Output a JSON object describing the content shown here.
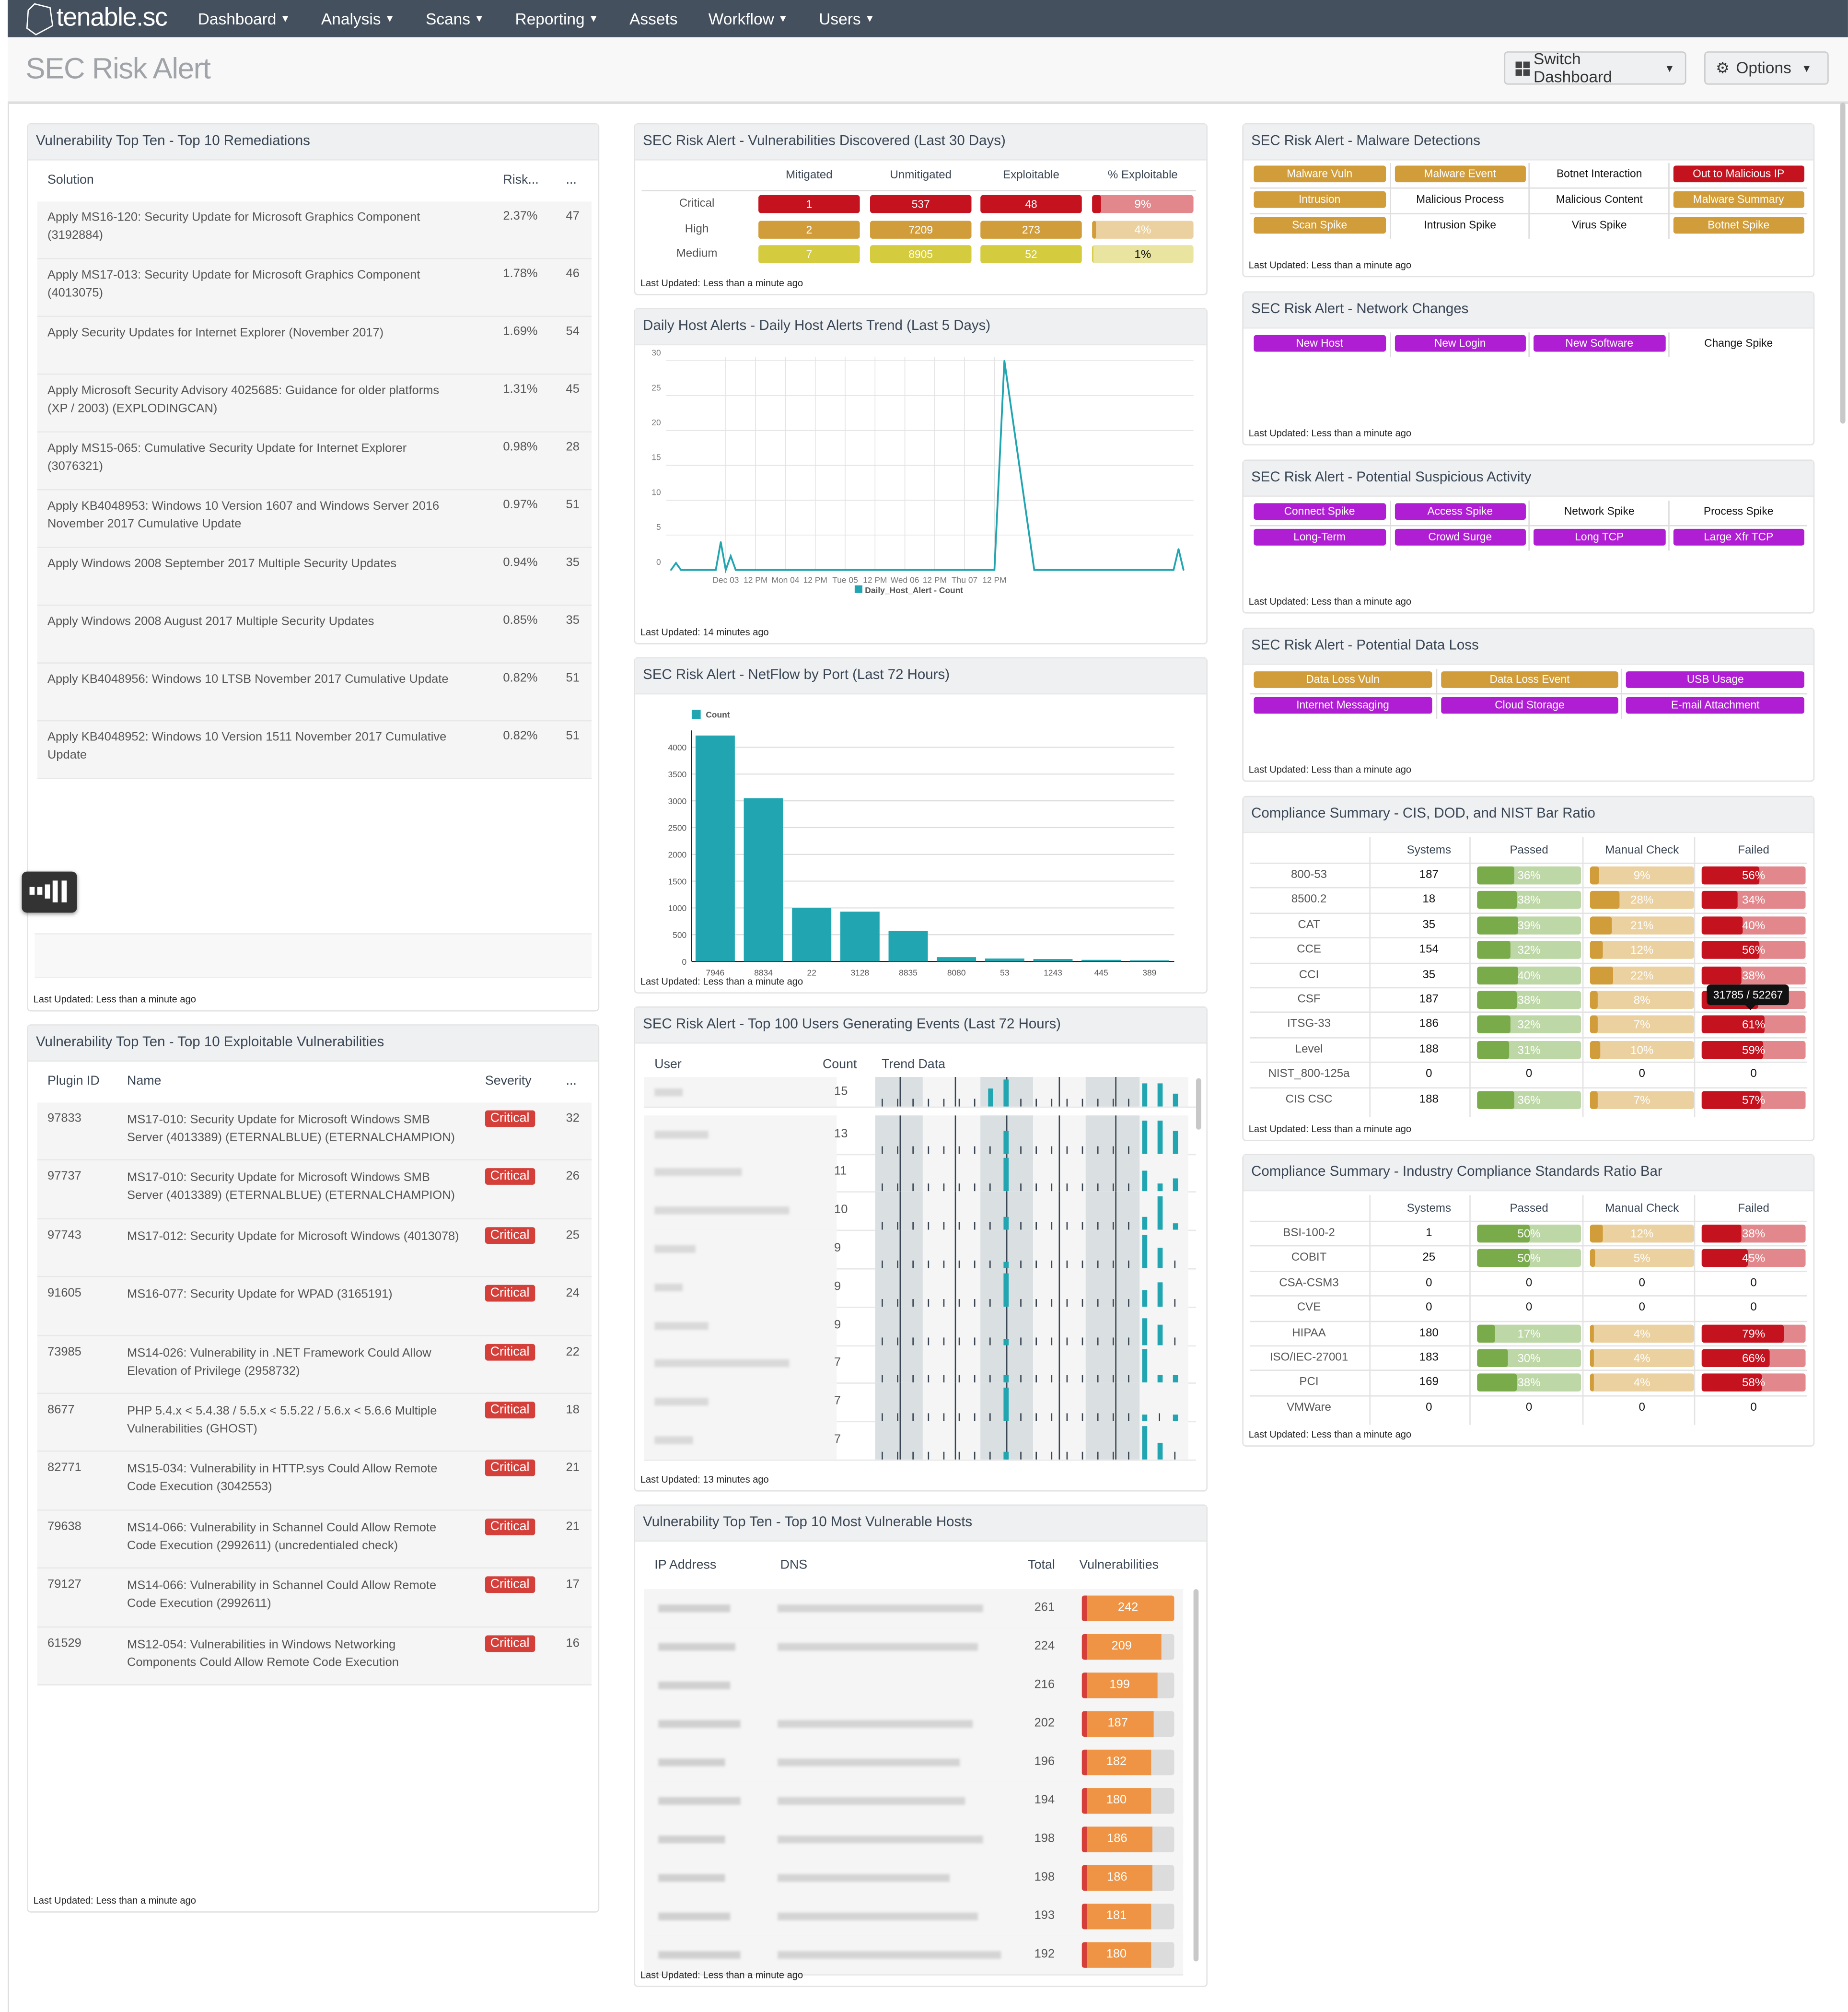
{
  "app": {
    "logo_text": "tenable.sc"
  },
  "nav": [
    {
      "label": "Dashboard",
      "has_menu": true
    },
    {
      "label": "Analysis",
      "has_menu": true
    },
    {
      "label": "Scans",
      "has_menu": true
    },
    {
      "label": "Reporting",
      "has_menu": true
    },
    {
      "label": "Assets",
      "has_menu": false
    },
    {
      "label": "Workflow",
      "has_menu": true
    },
    {
      "label": "Users",
      "has_menu": true
    }
  ],
  "page": {
    "title": "SEC Risk Alert",
    "switch_dashboard_label": "Switch Dashboard",
    "options_label": "Options"
  },
  "remediations": {
    "title": "Vulnerability Top Ten - Top 10 Remediations",
    "headers": [
      "Solution",
      "Risk...",
      "..."
    ],
    "rows": [
      [
        "Apply MS16-120: Security Update for Microsoft Graphics Component (3192884)",
        "2.37%",
        "47"
      ],
      [
        "Apply MS17-013: Security Update for Microsoft Graphics Component (4013075)",
        "1.78%",
        "46"
      ],
      [
        "Apply Security Updates for Internet Explorer (November 2017)",
        "1.69%",
        "54"
      ],
      [
        "Apply Microsoft Security Advisory 4025685: Guidance for older platforms (XP / 2003) (EXPLODINGCAN)",
        "1.31%",
        "45"
      ],
      [
        "Apply MS15-065: Cumulative Security Update for Internet Explorer (3076321)",
        "0.98%",
        "28"
      ],
      [
        "Apply KB4048953: Windows 10 Version 1607 and Windows Server 2016 November 2017 Cumulative Update",
        "0.97%",
        "51"
      ],
      [
        "Apply Windows 2008 September 2017 Multiple Security Updates",
        "0.94%",
        "35"
      ],
      [
        "Apply Windows 2008 August 2017 Multiple Security Updates",
        "0.85%",
        "35"
      ],
      [
        "Apply KB4048956: Windows 10 LTSB November 2017 Cumulative Update",
        "0.82%",
        "51"
      ],
      [
        "Apply KB4048952: Windows 10 Version 1511 November 2017 Cumulative Update",
        "0.82%",
        "51"
      ]
    ],
    "updated": "Last Updated: Less than a minute ago"
  },
  "exploitable": {
    "title": "Vulnerability Top Ten - Top 10 Exploitable Vulnerabilities",
    "headers": [
      "Plugin ID",
      "Name",
      "Severity",
      "..."
    ],
    "rows": [
      [
        "97833",
        "MS17-010: Security Update for Microsoft Windows SMB Server (4013389) (ETERNALBLUE) (ETERNALCHAMPION)",
        "Critical",
        "32"
      ],
      [
        "97737",
        "MS17-010: Security Update for Microsoft Windows SMB Server (4013389) (ETERNALBLUE) (ETERNALCHAMPION)",
        "Critical",
        "26"
      ],
      [
        "97743",
        "MS17-012: Security Update for Microsoft Windows (4013078)",
        "Critical",
        "25"
      ],
      [
        "91605",
        "MS16-077: Security Update for WPAD (3165191)",
        "Critical",
        "24"
      ],
      [
        "73985",
        "MS14-026: Vulnerability in .NET Framework Could Allow Elevation of Privilege (2958732)",
        "Critical",
        "22"
      ],
      [
        "8677",
        "PHP 5.4.x < 5.4.38 / 5.5.x < 5.5.22 / 5.6.x < 5.6.6 Multiple Vulnerabilities (GHOST)",
        "Critical",
        "18"
      ],
      [
        "82771",
        "MS15-034: Vulnerability in HTTP.sys Could Allow Remote Code Execution (3042553)",
        "Critical",
        "21"
      ],
      [
        "79638",
        "MS14-066: Vulnerability in Schannel Could Allow Remote Code Execution (2992611) (uncredentialed check)",
        "Critical",
        "21"
      ],
      [
        "79127",
        "MS14-066: Vulnerability in Schannel Could Allow Remote Code Execution (2992611)",
        "Critical",
        "17"
      ],
      [
        "61529",
        "MS12-054: Vulnerabilities in Windows Networking Components Could Allow Remote Code Execution",
        "Critical",
        "16"
      ]
    ],
    "updated": "Last Updated: Less than a minute ago"
  },
  "vulns_discovered": {
    "title": "SEC Risk Alert - Vulnerabilities Discovered (Last 30 Days)",
    "headers": [
      "Mitigated",
      "Unmitigated",
      "Exploitable",
      "% Exploitable"
    ],
    "rows": [
      {
        "label": "Critical",
        "mitigated": "1",
        "unmitigated": "537",
        "exploitable": "48",
        "pct": "9%",
        "pct_value": 9,
        "color": "#c4121f",
        "light": "#e2888d",
        "pct_text_color": "#ffffff"
      },
      {
        "label": "High",
        "mitigated": "2",
        "unmitigated": "7209",
        "exploitable": "273",
        "pct": "4%",
        "pct_value": 4,
        "color": "#d19d3b",
        "light": "#ebd0a0",
        "pct_text_color": "#ffffff"
      },
      {
        "label": "Medium",
        "mitigated": "7",
        "unmitigated": "8905",
        "exploitable": "52",
        "pct": "1%",
        "pct_value": 1,
        "color": "#d4cb3e",
        "light": "#e9e4a0",
        "pct_text_color": "#111111"
      }
    ],
    "updated": "Last Updated: Less than a minute ago"
  },
  "host_alerts": {
    "title": "Daily Host Alerts - Daily Host Alerts Trend (Last 5 Days)",
    "updated": "Last Updated: 14 minutes ago"
  },
  "netflow": {
    "title": "SEC Risk Alert - NetFlow by Port (Last 72 Hours)",
    "updated": "Last Updated: Less than a minute ago"
  },
  "top_users": {
    "title": "SEC Risk Alert - Top 100 Users Generating Events (Last 72 Hours)",
    "headers": [
      "User",
      "Count",
      "Trend Data"
    ],
    "counts": [
      "15",
      "13",
      "11",
      "10",
      "9",
      "9",
      "9",
      "7",
      "7",
      "7"
    ],
    "updated": "Last Updated: 13 minutes ago"
  },
  "vuln_hosts": {
    "title": "Vulnerability Top Ten - Top 10 Most Vulnerable Hosts",
    "headers": [
      "IP Address",
      "DNS",
      "Total",
      "Vulnerabilities"
    ],
    "rows": [
      {
        "total": "261",
        "vulns": "242",
        "ratio": 0.927
      },
      {
        "total": "224",
        "vulns": "209",
        "ratio": 0.933
      },
      {
        "total": "216",
        "vulns": "199",
        "ratio": 0.921
      },
      {
        "total": "202",
        "vulns": "187",
        "ratio": 0.926
      },
      {
        "total": "196",
        "vulns": "182",
        "ratio": 0.929
      },
      {
        "total": "194",
        "vulns": "180",
        "ratio": 0.928
      },
      {
        "total": "198",
        "vulns": "186",
        "ratio": 0.939
      },
      {
        "total": "198",
        "vulns": "186",
        "ratio": 0.939
      },
      {
        "total": "193",
        "vulns": "181",
        "ratio": 0.938
      },
      {
        "total": "192",
        "vulns": "180",
        "ratio": 0.938
      }
    ],
    "updated": "Last Updated: Less than a minute ago"
  },
  "malware": {
    "title": "SEC Risk Alert - Malware Detections",
    "cells": [
      [
        {
          "label": "Malware Vuln",
          "color": "#d19d3b"
        },
        {
          "label": "Malware Event",
          "color": "#d19d3b"
        },
        {
          "label": "Botnet Interaction",
          "color": null
        },
        {
          "label": "Out to Malicious IP",
          "color": "#c4121f"
        }
      ],
      [
        {
          "label": "Intrusion",
          "color": "#d19d3b"
        },
        {
          "label": "Malicious Process",
          "color": null
        },
        {
          "label": "Malicious Content",
          "color": null
        },
        {
          "label": "Malware Summary",
          "color": "#d19d3b"
        }
      ],
      [
        {
          "label": "Scan Spike",
          "color": "#d19d3b"
        },
        {
          "label": "Intrusion Spike",
          "color": null
        },
        {
          "label": "Virus Spike",
          "color": null
        },
        {
          "label": "Botnet Spike",
          "color": "#d19d3b"
        }
      ]
    ],
    "updated": "Last Updated: Less than a minute ago"
  },
  "network_changes": {
    "title": "SEC Risk Alert - Network Changes",
    "cells": [
      [
        {
          "label": "New Host",
          "color": "#b01ed3"
        },
        {
          "label": "New Login",
          "color": "#b01ed3"
        },
        {
          "label": "New Software",
          "color": "#b01ed3"
        },
        {
          "label": "Change Spike",
          "color": null
        }
      ]
    ],
    "updated": "Last Updated: Less than a minute ago"
  },
  "suspicious": {
    "title": "SEC Risk Alert - Potential Suspicious Activity",
    "cells": [
      [
        {
          "label": "Connect Spike",
          "color": "#b01ed3"
        },
        {
          "label": "Access Spike",
          "color": "#b01ed3"
        },
        {
          "label": "Network Spike",
          "color": null
        },
        {
          "label": "Process Spike",
          "color": null
        }
      ],
      [
        {
          "label": "Long-Term",
          "color": "#b01ed3"
        },
        {
          "label": "Crowd Surge",
          "color": "#b01ed3"
        },
        {
          "label": "Long TCP",
          "color": "#b01ed3"
        },
        {
          "label": "Large Xfr TCP",
          "color": "#b01ed3"
        }
      ]
    ],
    "updated": "Last Updated: Less than a minute ago"
  },
  "data_loss": {
    "title": "SEC Risk Alert - Potential Data Loss",
    "cells": [
      [
        {
          "label": "Data Loss Vuln",
          "color": "#d19d3b"
        },
        {
          "label": "Data Loss Event",
          "color": "#d19d3b"
        },
        {
          "label": "USB Usage",
          "color": "#b01ed3"
        }
      ],
      [
        {
          "label": "Internet Messaging",
          "color": "#b01ed3"
        },
        {
          "label": "Cloud Storage",
          "color": "#b01ed3"
        },
        {
          "label": "E-mail Attachment",
          "color": "#b01ed3"
        }
      ]
    ],
    "updated": "Last Updated: Less than a minute ago"
  },
  "compliance_cis": {
    "title": "Compliance Summary - CIS, DOD, and NIST Bar Ratio",
    "headers": [
      "Systems",
      "Passed",
      "Manual Check",
      "Failed"
    ],
    "rows": [
      {
        "name": "800-53",
        "systems": "187",
        "passed": 36,
        "manual": 9,
        "failed": 56
      },
      {
        "name": "8500.2",
        "systems": "18",
        "passed": 38,
        "manual": 28,
        "failed": 34
      },
      {
        "name": "CAT",
        "systems": "35",
        "passed": 39,
        "manual": 21,
        "failed": 40
      },
      {
        "name": "CCE",
        "systems": "154",
        "passed": 32,
        "manual": 12,
        "failed": 56
      },
      {
        "name": "CCI",
        "systems": "35",
        "passed": 40,
        "manual": 22,
        "failed": 38
      },
      {
        "name": "CSF",
        "systems": "187",
        "passed": 38,
        "manual": 8,
        "failed": 54
      },
      {
        "name": "ITSG-33",
        "systems": "186",
        "passed": 32,
        "manual": 7,
        "failed": 61
      },
      {
        "name": "Level",
        "systems": "188",
        "passed": 31,
        "manual": 10,
        "failed": 59
      },
      {
        "name": "NIST_800-125a",
        "systems": "0",
        "passed": null,
        "manual": null,
        "failed": null
      },
      {
        "name": "CIS CSC",
        "systems": "188",
        "passed": 36,
        "manual": 7,
        "failed": 57
      }
    ],
    "tooltip": "31785 / 52267",
    "updated": "Last Updated: Less than a minute ago"
  },
  "compliance_industry": {
    "title": "Compliance Summary - Industry Compliance Standards Ratio Bar",
    "headers": [
      "Systems",
      "Passed",
      "Manual Check",
      "Failed"
    ],
    "rows": [
      {
        "name": "BSI-100-2",
        "systems": "1",
        "passed": 50,
        "manual": 12,
        "failed": 38
      },
      {
        "name": "COBIT",
        "systems": "25",
        "passed": 50,
        "manual": 5,
        "failed": 45
      },
      {
        "name": "CSA-CSM3",
        "systems": "0",
        "passed": null,
        "manual": null,
        "failed": null
      },
      {
        "name": "CVE",
        "systems": "0",
        "passed": null,
        "manual": null,
        "failed": null
      },
      {
        "name": "HIPAA",
        "systems": "180",
        "passed": 17,
        "manual": 4,
        "failed": 79
      },
      {
        "name": "ISO/IEC-27001",
        "systems": "183",
        "passed": 30,
        "manual": 4,
        "failed": 66
      },
      {
        "name": "PCI",
        "systems": "169",
        "passed": 38,
        "manual": 4,
        "failed": 58
      },
      {
        "name": "VMWare",
        "systems": "0",
        "passed": null,
        "manual": null,
        "failed": null
      }
    ],
    "updated": "Last Updated: Less than a minute ago"
  },
  "colors": {
    "passed_dark": "#7aab4a",
    "passed_light": "#bdd7a6",
    "manual_dark": "#d19d3b",
    "manual_light": "#ebd0a0",
    "failed_dark": "#c4121f",
    "failed_light": "#e2888d",
    "teal": "#21a5b1",
    "orange": "#ee9444",
    "vuln_red": "#d43f3a"
  },
  "chart_data": [
    {
      "type": "line",
      "title": "Daily Host Alerts - Daily Host Alerts Trend (Last 5 Days)",
      "xlabel": "",
      "ylabel": "",
      "ylim": [
        0,
        30
      ],
      "yticks": [
        0,
        5,
        10,
        15,
        20,
        25,
        30
      ],
      "xticks": [
        "Dec 03",
        "12 PM",
        "Mon 04",
        "12 PM",
        "Tue 05",
        "12 PM",
        "Wed 06",
        "12 PM",
        "Thu 07",
        "12 PM"
      ],
      "legend": [
        "Daily_Host_Alert - Count"
      ],
      "legend_position": "bottom",
      "series": [
        {
          "name": "Daily_Host_Alert - Count",
          "color": "#21a5b1",
          "x_hours": [
            -20,
            -18,
            -16,
            -6,
            -2,
            0,
            2,
            4,
            6,
            106,
            110,
            114,
            126,
            178,
            182,
            184,
            186
          ],
          "values": [
            0,
            1,
            0,
            0,
            0,
            4,
            0,
            2,
            0,
            0,
            0,
            30,
            0,
            0,
            0,
            3,
            0
          ]
        }
      ]
    },
    {
      "type": "bar",
      "title": "SEC Risk Alert - NetFlow by Port (Last 72 Hours)",
      "categories": [
        "7946",
        "8834",
        "22",
        "3128",
        "8835",
        "8080",
        "53",
        "1243",
        "445",
        "389"
      ],
      "values": [
        4220,
        3050,
        1000,
        930,
        570,
        80,
        55,
        45,
        30,
        20
      ],
      "ylim": [
        0,
        4200
      ],
      "yticks": [
        0,
        500,
        1000,
        1500,
        2000,
        2500,
        3000,
        3500,
        4000
      ],
      "legend": [
        "Count"
      ],
      "legend_position": "top-left",
      "xlabel": "",
      "ylabel": ""
    }
  ]
}
